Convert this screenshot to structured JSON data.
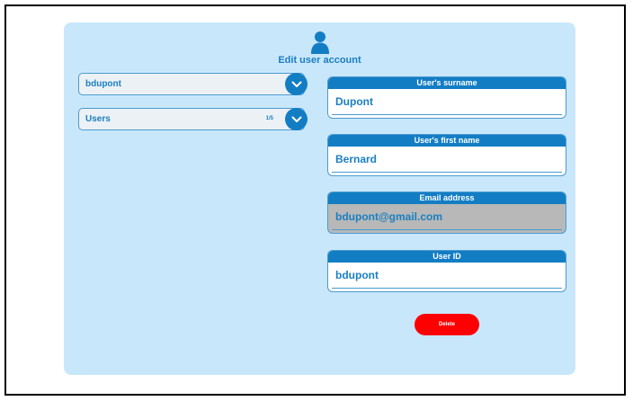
{
  "form": {
    "title": "Edit user account",
    "icons": {
      "header": "user-icon",
      "dropdown": "chevron-down-icon"
    }
  },
  "user_select": {
    "value": "bdupont"
  },
  "group_select": {
    "value": "Users",
    "pager": "1/5"
  },
  "fields": {
    "surname": {
      "label": "User's surname",
      "value": "Dupont"
    },
    "first_name": {
      "label": "User's first name",
      "value": "Bernard"
    },
    "email": {
      "label": "Email address",
      "value": "bdupont@gmail.com"
    },
    "user_id": {
      "label": "User ID",
      "value": "bdupont"
    }
  },
  "actions": {
    "delete_label": "Delete"
  },
  "colors": {
    "panel": "#c9e7fb",
    "accent": "#137dc4",
    "text_accent": "#1a7fc1",
    "danger": "#ff0000",
    "disabled": "#b8b8b8"
  }
}
